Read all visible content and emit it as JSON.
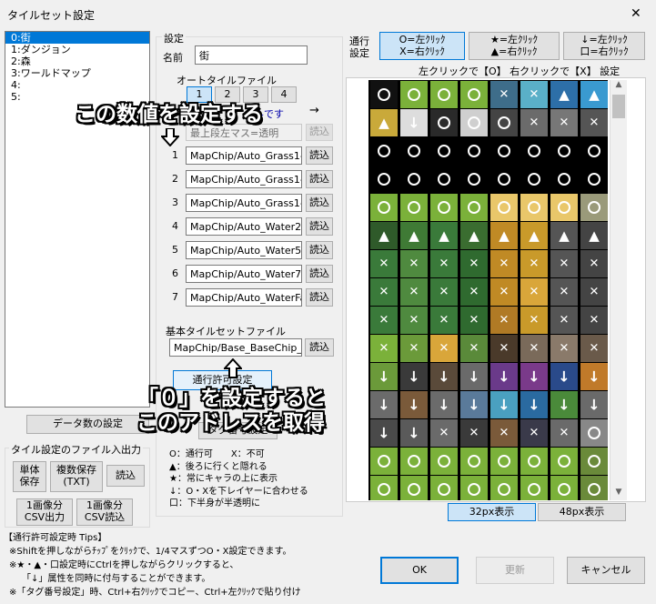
{
  "window": {
    "title": "タイルセット設定",
    "close": "✕"
  },
  "tileset_list": [
    "0:街",
    "1:ダンジョン",
    "2:森",
    "3:ワールドマップ",
    "4:",
    "5:"
  ],
  "data_count_button": "データ数の設定",
  "tileset_io": {
    "group_label": "タイル設定のファイル入出力",
    "single_save": "単体\n保存",
    "multi_save": "複数保存\n(TXT)",
    "load": "読込",
    "csv_out": "1画像分\nCSV出力",
    "csv_in": "1画像分\nCSV読込"
  },
  "settings": {
    "group_label": "設定",
    "name_label": "名前",
    "name_value": "街",
    "autotile_label": "オートタイルファイル",
    "autotile_tabs": [
      "1",
      "2",
      "3",
      "4"
    ],
    "autotile_tabs_selected": 0,
    "hint_text": "…ルです",
    "hint_arrow": "→",
    "first_row_value": "最上段左マス=透明",
    "autotile_rows": [
      {
        "num": "1",
        "path": "MapChip/Auto_Grass1-"
      },
      {
        "num": "2",
        "path": "MapChip/Auto_Grass1-"
      },
      {
        "num": "3",
        "path": "MapChip/Auto_Grass1-"
      },
      {
        "num": "4",
        "path": "MapChip/Auto_Water2"
      },
      {
        "num": "5",
        "path": "MapChip/Auto_Water5"
      },
      {
        "num": "6",
        "path": "MapChip/Auto_Water7"
      },
      {
        "num": "7",
        "path": "MapChip/Auto_WaterFa"
      }
    ],
    "load_label": "読込",
    "base_label": "基本タイルセットファイル",
    "base_path": "MapChip/Base_BaseChip_",
    "passability_button": "通行許可設定",
    "tag_button": "タグ番号設定"
  },
  "legend": [
    "O：通行可　　X：不可",
    "▲：後ろに行くと隠れる",
    "★：常にキャラの上に表示",
    "↓：O・Xを下レイヤーに合わせる",
    "口：下半身が半透明に"
  ],
  "callouts": {
    "top": "この数値を設定する",
    "bottom1": "「０」を設定すると",
    "bottom2": "このアドレスを取得"
  },
  "passage": {
    "label": "通行\n設定",
    "mode1": "O=左ｸﾘｯｸ\nX=右ｸﾘｯｸ",
    "mode2": "★=左ｸﾘｯｸ\n▲=右ｸﾘｯｸ",
    "mode3": "↓=左ｸﾘｯｸ\n口=右ｸﾘｯｸ",
    "instruction": "左クリックで【O】 右クリックで【X】 設定"
  },
  "zoom": {
    "option32": "32px表示",
    "option48": "48px表示"
  },
  "tips": {
    "title": "【通行許可設定時 Tips】",
    "lines": [
      "※Shiftを押しながらﾁｯﾌﾟをｸﾘｯｸで、1/4マスずつO・X設定できます。",
      "※★・▲・口設定時にCtrlを押しながらクリックすると、",
      "「↓」属性を同時に付与することができます。",
      "※「タグ番号設定」時、Ctrl+右ｸﾘｯｸでコピー、Ctrl+左ｸﾘｯｸで貼り付け"
    ]
  },
  "footer": {
    "ok": "OK",
    "update": "更新",
    "cancel": "キャンセル"
  },
  "colors": {
    "accent": "#0078d7",
    "selected_bg": "#cce4f7",
    "grass": "#7bb13a",
    "water": "#3a9ad0",
    "sand": "#e9c76a"
  }
}
